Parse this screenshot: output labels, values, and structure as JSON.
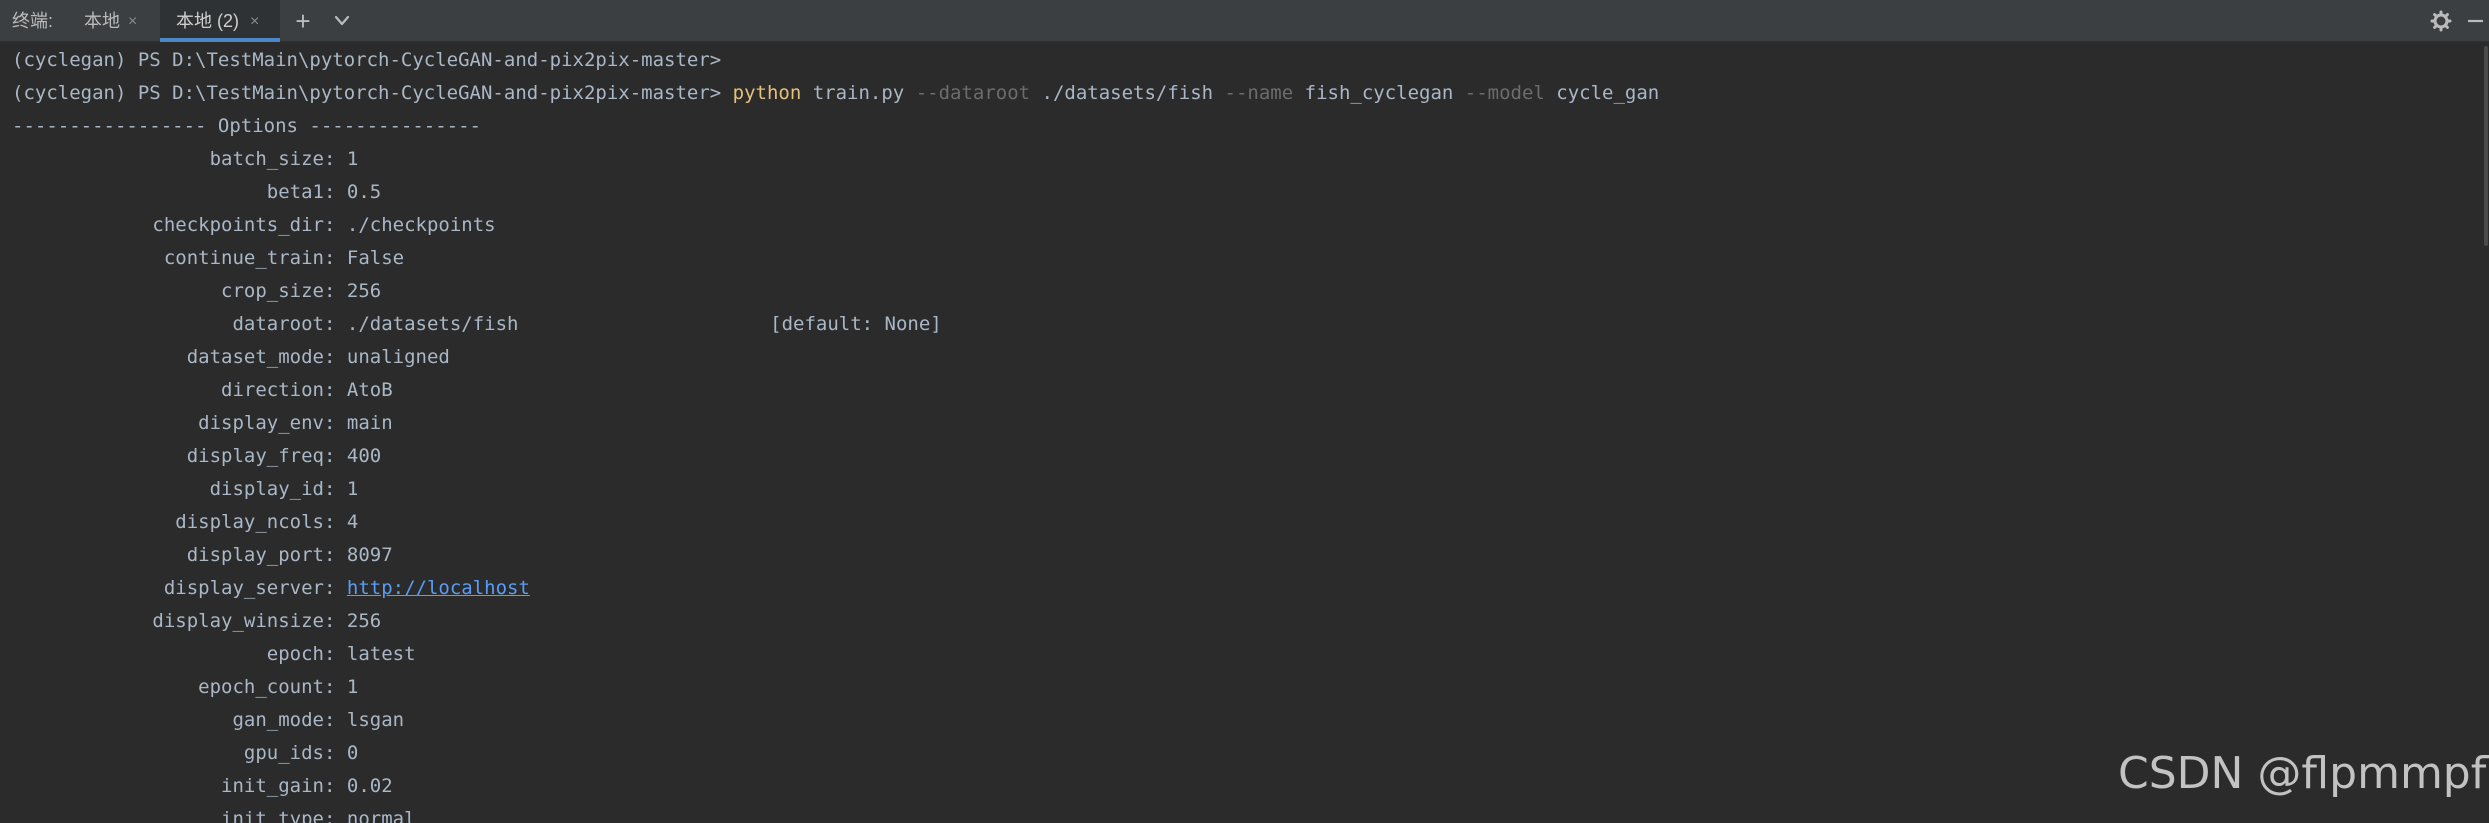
{
  "tabbar": {
    "title": "终端:",
    "tabs": [
      {
        "label": "本地",
        "close": "×"
      },
      {
        "label": "本地 (2)",
        "close": "×"
      }
    ],
    "add_icon": "+",
    "chevron_icon": "chevron-down-icon",
    "settings_icon": "gear-icon",
    "minimize_icon": "minimize-icon"
  },
  "terminal": {
    "prompt_line": "(cyclegan) PS D:\\TestMain\\pytorch-CycleGAN-and-pix2pix-master>",
    "command": {
      "prompt": "(cyclegan) PS D:\\TestMain\\pytorch-CycleGAN-and-pix2pix-master> ",
      "python": "python",
      "script": " train.py ",
      "flag1": "--dataroot",
      "val1": " ./datasets/fish ",
      "flag2": "--name",
      "val2": " fish_cyclegan ",
      "flag3": "--model",
      "val3": " cycle_gan"
    },
    "options_header": "----------------- Options ---------------",
    "options": [
      {
        "key": "batch_size",
        "value": "1"
      },
      {
        "key": "beta1",
        "value": "0.5"
      },
      {
        "key": "checkpoints_dir",
        "value": "./checkpoints"
      },
      {
        "key": "continue_train",
        "value": "False"
      },
      {
        "key": "crop_size",
        "value": "256"
      },
      {
        "key": "dataroot",
        "value": "./datasets/fish                      [default: None]"
      },
      {
        "key": "dataset_mode",
        "value": "unaligned"
      },
      {
        "key": "direction",
        "value": "AtoB"
      },
      {
        "key": "display_env",
        "value": "main"
      },
      {
        "key": "display_freq",
        "value": "400"
      },
      {
        "key": "display_id",
        "value": "1"
      },
      {
        "key": "display_ncols",
        "value": "4"
      },
      {
        "key": "display_port",
        "value": "8097"
      },
      {
        "key": "display_server",
        "value": "http://localhost",
        "link": true
      },
      {
        "key": "display_winsize",
        "value": "256"
      },
      {
        "key": "epoch",
        "value": "latest"
      },
      {
        "key": "epoch_count",
        "value": "1"
      },
      {
        "key": "gan_mode",
        "value": "lsgan"
      },
      {
        "key": "gpu_ids",
        "value": "0"
      },
      {
        "key": "init_gain",
        "value": "0.02"
      },
      {
        "key": "init_type",
        "value": "normal"
      }
    ],
    "separator": ": "
  },
  "watermark": "CSDN @flpmmpfl",
  "colors": {
    "background": "#2b2b2b",
    "tabbar": "#3c3f41",
    "text": "#a9b7c6",
    "python_keyword": "#e5c07b",
    "flag": "#6c6c6c",
    "link": "#589df6",
    "active_tab_underline": "#4a88c7"
  }
}
